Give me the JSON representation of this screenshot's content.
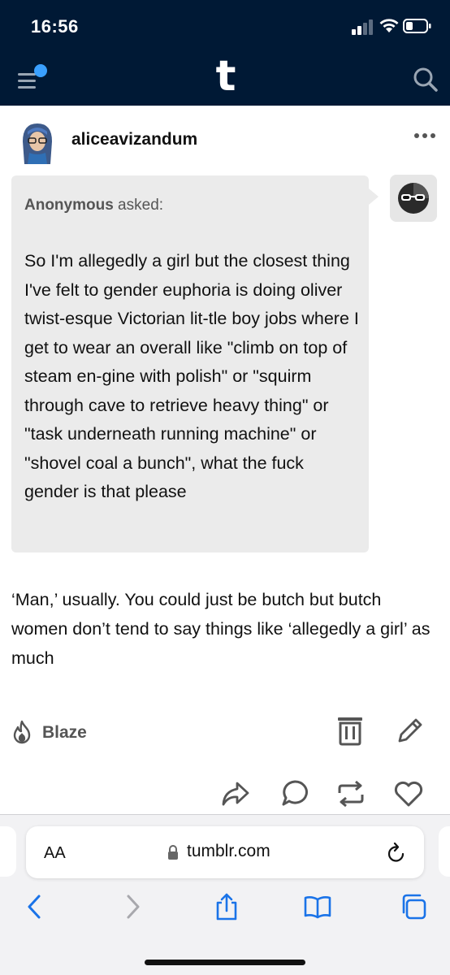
{
  "status_bar": {
    "time": "16:56"
  },
  "nav": {
    "logo": "t"
  },
  "post": {
    "username": "aliceavizandum",
    "ask": {
      "asker": "Anonymous",
      "asked_label": " asked:",
      "question": "So I'm allegedly a girl but the closest thing I've felt to gender euphoria is doing oliver twist-esque Victorian lit-tle boy jobs where I get to wear an overall like \"climb on top of steam en-gine with polish\" or \"squirm through cave to retrieve heavy thing\" or \"task underneath running machine\" or \"shovel coal a bunch\", what the fuck gender is that please"
    },
    "answer": "‘Man,’ usually. You could just be butch but butch women don’t tend to say things like ‘allegedly a girl’ as much",
    "actions": {
      "blaze_label": "Blaze"
    }
  },
  "browser": {
    "text_size_label": "AA",
    "url": "tumblr.com"
  },
  "colors": {
    "nav_bg": "#001935",
    "notification_dot": "#3aa0ff",
    "ask_bg": "#ebebeb",
    "safari_blue": "#1a73e8"
  },
  "icons": [
    "menu-icon",
    "search-icon",
    "more-icon",
    "blaze-icon",
    "trash-icon",
    "edit-icon",
    "share-icon",
    "reply-icon",
    "reblog-icon",
    "like-icon",
    "lock-icon",
    "reload-icon",
    "back-icon",
    "forward-icon",
    "share-sheet-icon",
    "bookmarks-icon",
    "tabs-icon"
  ]
}
